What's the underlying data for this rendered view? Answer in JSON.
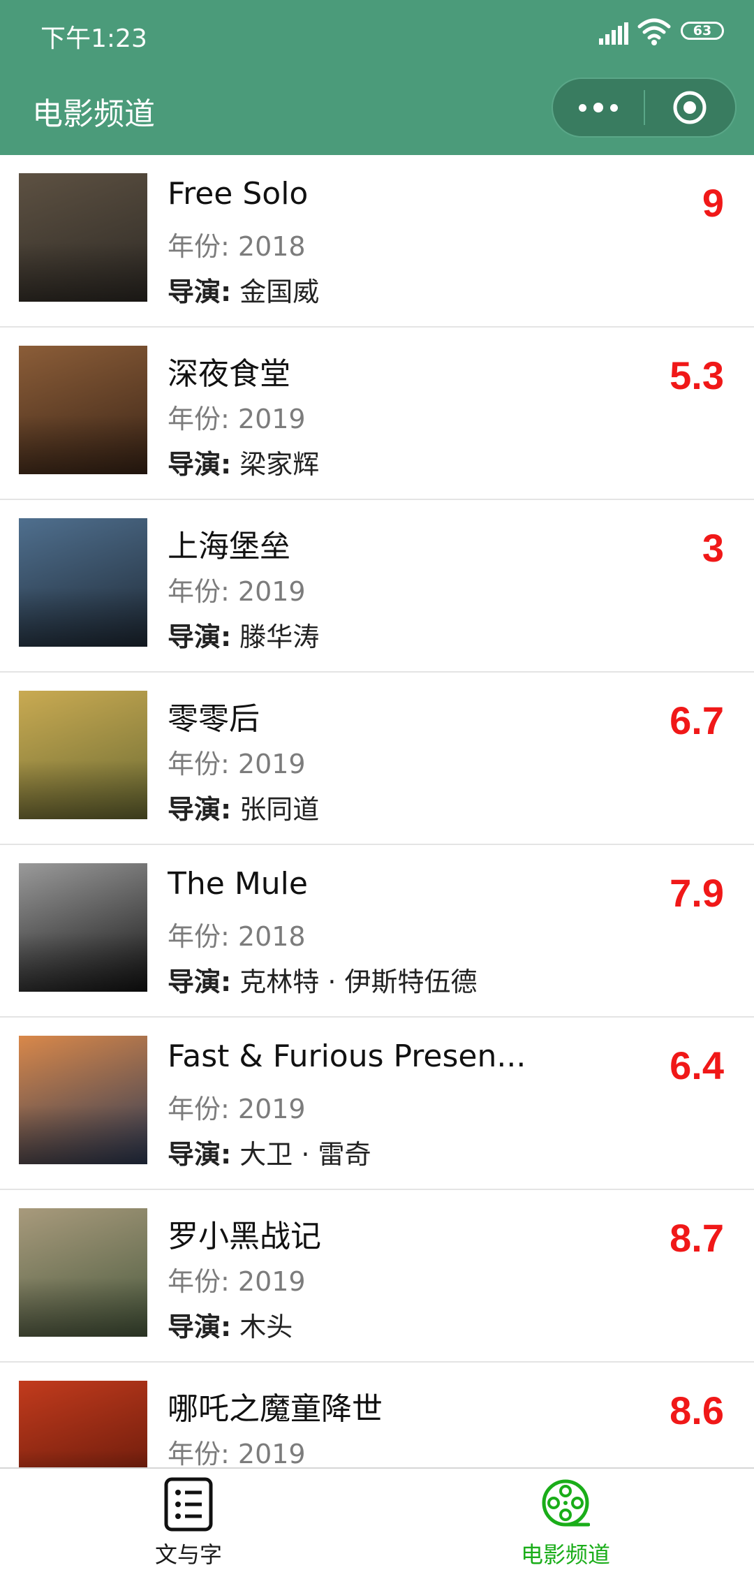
{
  "status_bar": {
    "time": "下午1:23",
    "battery": "63"
  },
  "nav": {
    "title": "电影频道"
  },
  "year_label": "年份:",
  "director_label": "导演:",
  "movies": [
    {
      "title": "Free Solo",
      "year": "2018",
      "director": "金国威",
      "rating": "9",
      "poster_colors": [
        "#5d5142",
        "#2e2a25"
      ]
    },
    {
      "title": "深夜食堂",
      "year": "2019",
      "director": "梁家辉",
      "rating": "5.3",
      "poster_colors": [
        "#8b5d38",
        "#3b2517"
      ]
    },
    {
      "title": "上海堡垒",
      "year": "2019",
      "director": "滕华涛",
      "rating": "3",
      "poster_colors": [
        "#4f6f8e",
        "#1f2a36"
      ]
    },
    {
      "title": "零零后",
      "year": "2019",
      "director": "张同道",
      "rating": "6.7",
      "poster_colors": [
        "#c9aa52",
        "#6b6b33"
      ]
    },
    {
      "title": "The Mule",
      "year": "2018",
      "director": "克林特 · 伊斯特伍德",
      "rating": "7.9",
      "poster_colors": [
        "#9a9a9a",
        "#141414"
      ]
    },
    {
      "title": "Fast & Furious Presen...",
      "year": "2019",
      "director": "大卫 · 雷奇",
      "rating": "6.4",
      "poster_colors": [
        "#d9884a",
        "#2d3a55"
      ]
    },
    {
      "title": "罗小黑战记",
      "year": "2019",
      "director": "木头",
      "rating": "8.7",
      "poster_colors": [
        "#a89a7c",
        "#4a5a3e"
      ]
    },
    {
      "title": "哪吒之魔童降世",
      "year": "2019",
      "director": "",
      "rating": "8.6",
      "poster_colors": [
        "#c23b1d",
        "#5a1508"
      ]
    }
  ],
  "tabs": [
    {
      "label": "文与字",
      "icon": "list-icon",
      "active": false
    },
    {
      "label": "电影频道",
      "icon": "film-reel-icon",
      "active": true
    }
  ],
  "colors": {
    "header": "#4b9b7a",
    "rating": "#f01818",
    "active_tab": "#1aad19"
  }
}
